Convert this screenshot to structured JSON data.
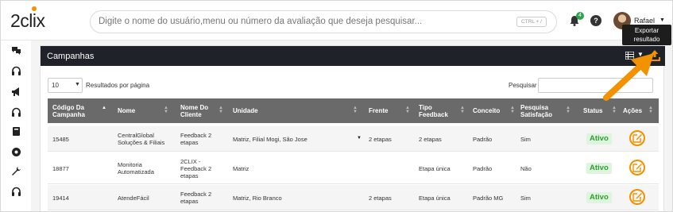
{
  "header": {
    "logo_text": "2clix",
    "search_placeholder": "Digite o nome do usuário,menu ou número da avaliação que deseja pesquisar...",
    "shortcut_hint": "CTRL + /",
    "notification_count": "4",
    "help_label": "?",
    "user_name": "Rafael"
  },
  "tooltip": {
    "line1": "Exportar",
    "line2": "resultado"
  },
  "sidebar": {
    "icons": [
      "chat-icon",
      "headset-icon",
      "megaphone-icon",
      "headset-icon",
      "book-icon",
      "settings-icon",
      "wrench-icon",
      "headset-icon"
    ]
  },
  "panel": {
    "title": "Campanhas",
    "page_length": "10",
    "page_length_label": "Resultados por página",
    "search_label": "Pesquisar"
  },
  "table": {
    "columns": [
      "Código Da Campanha",
      "Nome",
      "Nome Do Cliente",
      "Unidade",
      "Frente",
      "Tipo Feedback",
      "Conceito",
      "Pesquisa Satisfação",
      "Status",
      "Ações"
    ],
    "rows": [
      {
        "code": "15485",
        "name": "CentralGlobal Soluções & Filiais",
        "client": "Feedback 2 etapas",
        "unit": "Matriz, Filial Mogi, São Jose",
        "front": "2 etapas",
        "type": "2 etapas",
        "concept": "Padrão",
        "survey": "Sim",
        "status": "Ativo"
      },
      {
        "code": "18877",
        "name": "Monitoria Automatizada",
        "client": "2CLIX - Feedback 2 etapas",
        "unit": "Matriz",
        "front": "",
        "type": "Etapa única",
        "concept": "Padrão",
        "survey": "Não",
        "status": "Ativo"
      },
      {
        "code": "19414",
        "name": "AtendeFácil",
        "client": "Feedback 2 etapas",
        "unit": "Matriz, Rio Branco",
        "front": "2 etapas",
        "type": "Etapa única",
        "concept": "Padrão MG",
        "survey": "Sim",
        "status": "Ativo"
      }
    ]
  },
  "colors": {
    "accent": "#f39200",
    "panel_header": "#1f2229",
    "table_header": "#6a6a6a",
    "status_green": "#2ea02e",
    "status_bg": "#dff4de"
  }
}
